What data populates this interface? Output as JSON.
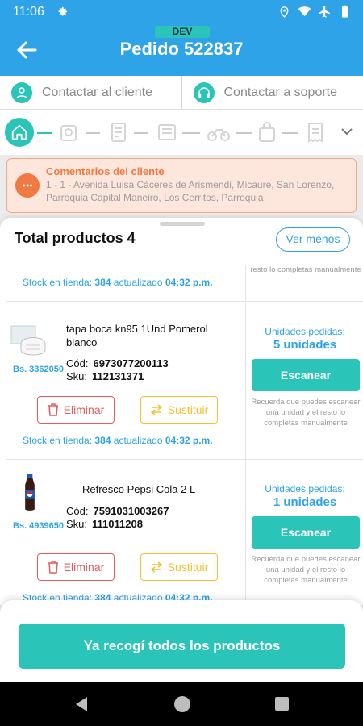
{
  "status_bar": {
    "time": "11:06"
  },
  "app_bar": {
    "badge": "DEV",
    "title": "Pedido 522837"
  },
  "contact": {
    "client_label": "Contactar al cliente",
    "support_label": "Contactar a soporte"
  },
  "comments": {
    "title": "Comentarios del cliente",
    "text": "1 - 1 - Avenida Luisa Cáceres de Arismendi, Micaure, San Lorenzo, Parroquia Capital Maneiro, Los Cerritos, Parroquia"
  },
  "products": {
    "header_title": "Total productos 4",
    "toggle_label": "Ver menos",
    "stock_prefix": "Stock en tienda:",
    "stock_updated": "actualizado",
    "units_label": "Unidades pedidas:",
    "scan_label": "Escanear",
    "scan_hint": "Recuerda que puedes escanear una unidad y el resto lo completas manualmente",
    "delete_label": "Eliminar",
    "substitute_label": "Sustituir",
    "cod_label": "Cód:",
    "sku_label": "Sku:",
    "partial_item": {
      "stock": "384",
      "time": "04:32 p.m.",
      "hint_tail": "resto lo completas manualmente"
    },
    "items": [
      {
        "name": "tapa boca kn95 1Und Pomerol blanco",
        "price": "Bs. 3362050",
        "cod": "6973077200113",
        "sku": "112131371",
        "units": "5 unidades",
        "stock": "384",
        "time": "04:32 p.m."
      },
      {
        "name": "Refresco Pepsi Cola 2 L",
        "price": "Bs. 4939650",
        "cod": "7591031003267",
        "sku": "111011208",
        "units": "1 unidades",
        "stock": "384",
        "time": "04:32 p.m."
      }
    ]
  },
  "bottom": {
    "button_label": "Ya recogí todos los productos"
  },
  "colors": {
    "primary": "#2ea3e8",
    "accent": "#2bc4b9",
    "warning": "#ef7a43",
    "danger": "#e75b5b",
    "yellow": "#f2c12e"
  },
  "icons": [
    "settings-icon",
    "location-icon",
    "wifi-icon",
    "airplane-icon",
    "battery-icon",
    "back-arrow-icon",
    "person-icon",
    "headset-icon",
    "home-icon",
    "chevron-down-icon",
    "chat-bubble-icon",
    "trash-icon",
    "swap-icon",
    "mask-product-image",
    "soda-bottle-image"
  ]
}
